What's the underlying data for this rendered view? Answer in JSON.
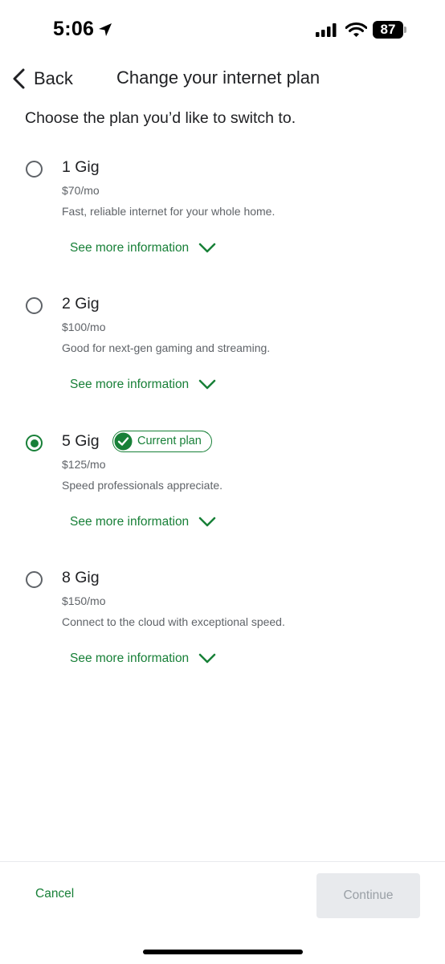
{
  "status_bar": {
    "time": "5:06",
    "battery_level": "87"
  },
  "header": {
    "back_label": "Back",
    "title": "Change your internet plan"
  },
  "intro": "Choose the plan you’d like to switch to.",
  "plans": [
    {
      "name": "1 Gig",
      "price": "$70/mo",
      "description": "Fast, reliable internet for your whole home.",
      "see_more": "See more information",
      "selected": false
    },
    {
      "name": "2 Gig",
      "price": "$100/mo",
      "description": "Good for next-gen gaming and streaming.",
      "see_more": "See more information",
      "selected": false
    },
    {
      "name": "5 Gig",
      "badge": "Current plan",
      "price": "$125/mo",
      "description": "Speed professionals appreciate.",
      "see_more": "See more information",
      "selected": true
    },
    {
      "name": "8 Gig",
      "price": "$150/mo",
      "description": "Connect to the cloud with exceptional speed.",
      "see_more": "See more information",
      "selected": false
    }
  ],
  "footer": {
    "cancel_label": "Cancel",
    "continue_label": "Continue",
    "continue_enabled": false
  },
  "colors": {
    "accent_green": "#188038",
    "disabled_bg": "#e8eaed",
    "disabled_text": "#9aa0a6",
    "secondary_text": "#5f6368"
  },
  "icons": {
    "location": "location-arrow-icon",
    "signal": "cellular-signal-icon",
    "wifi": "wifi-icon",
    "battery": "battery-icon",
    "back": "chevron-left-icon",
    "expand": "chevron-down-icon",
    "check": "check-circle-icon"
  }
}
